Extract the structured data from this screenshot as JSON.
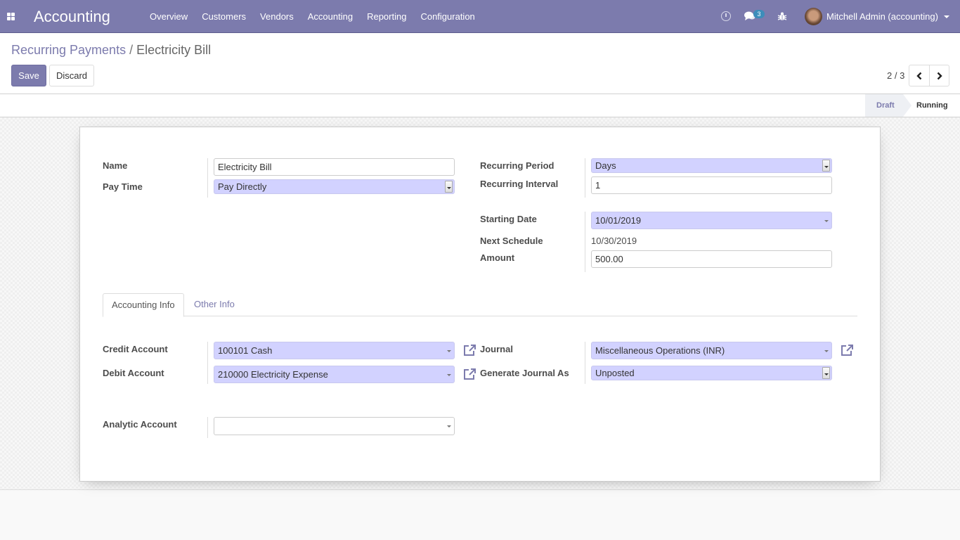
{
  "navbar": {
    "app_title": "Accounting",
    "menu": [
      "Overview",
      "Customers",
      "Vendors",
      "Accounting",
      "Reporting",
      "Configuration"
    ],
    "chat_badge": "3",
    "user": "Mitchell Admin (accounting)",
    "icons": [
      "apps-icon",
      "clock-icon",
      "chat-icon",
      "bug-icon",
      "avatar",
      "caret-down-icon"
    ]
  },
  "breadcrumb": {
    "parent": "Recurring Payments",
    "separator": "/",
    "current": "Electricity Bill"
  },
  "toolbar": {
    "save_label": "Save",
    "discard_label": "Discard"
  },
  "pager": {
    "value": "2 / 3"
  },
  "statusbar": {
    "stages": [
      "Draft",
      "Running"
    ],
    "active": "Running"
  },
  "form": {
    "name": {
      "label": "Name",
      "value": "Electricity Bill"
    },
    "pay_time": {
      "label": "Pay Time",
      "value": "Pay Directly"
    },
    "recurring_period": {
      "label": "Recurring Period",
      "value": "Days"
    },
    "recurring_interval": {
      "label": "Recurring Interval",
      "value": "1"
    },
    "starting_date": {
      "label": "Starting Date",
      "value": "10/01/2019"
    },
    "next_schedule": {
      "label": "Next Schedule",
      "value": "10/30/2019"
    },
    "amount": {
      "label": "Amount",
      "value": "500.00"
    }
  },
  "tabs": [
    {
      "label": "Accounting Info",
      "active": true
    },
    {
      "label": "Other Info",
      "active": false
    }
  ],
  "accounting_info": {
    "credit_account": {
      "label": "Credit Account",
      "value": "100101 Cash"
    },
    "debit_account": {
      "label": "Debit Account",
      "value": "210000 Electricity Expense"
    },
    "journal": {
      "label": "Journal",
      "value": "Miscellaneous Operations (INR)"
    },
    "generate_journal_as": {
      "label": "Generate Journal As",
      "value": "Unposted"
    },
    "analytic_account": {
      "label": "Analytic Account",
      "value": ""
    }
  },
  "colors": {
    "brand": "#7c7bad",
    "required_field": "#d2d2ff",
    "badge": "#3d8dba"
  }
}
